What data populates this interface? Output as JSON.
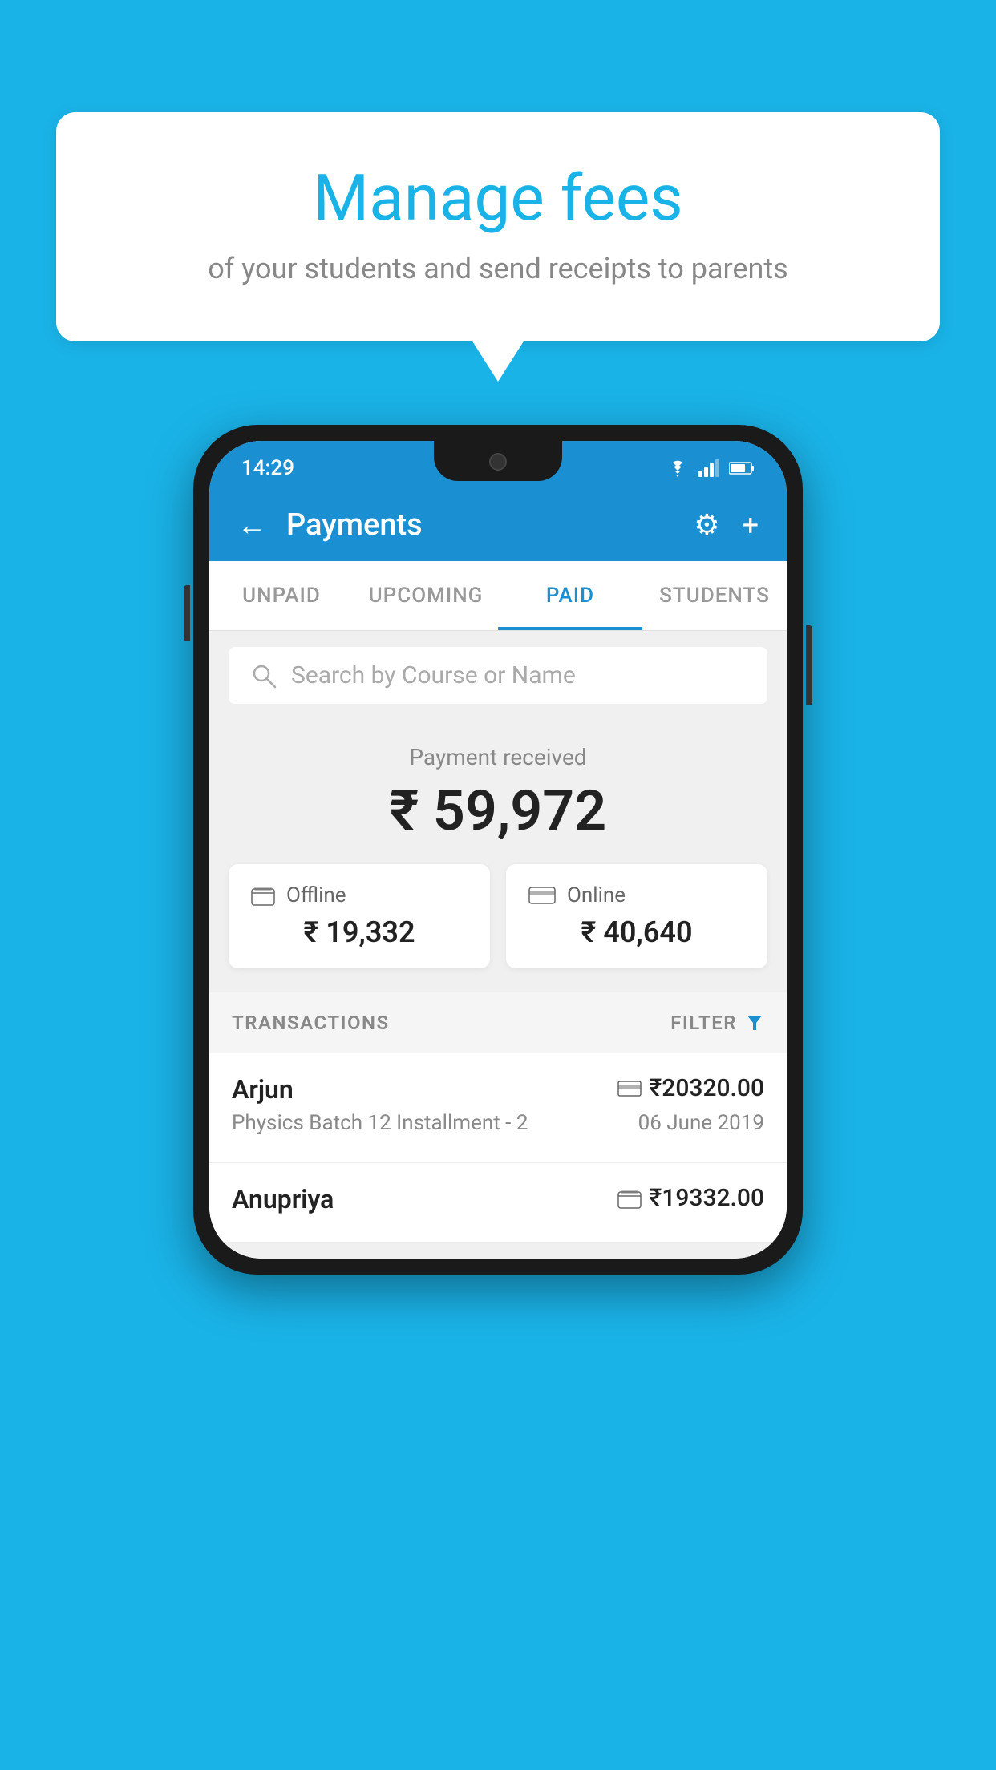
{
  "background_color": "#1ab3e8",
  "speech_bubble": {
    "title": "Manage fees",
    "subtitle": "of your students and send receipts to parents"
  },
  "status_bar": {
    "time": "14:29",
    "wifi": "▲",
    "signal": "▲",
    "battery": "▊"
  },
  "app_bar": {
    "title": "Payments",
    "back_label": "←",
    "gear_label": "⚙",
    "plus_label": "+"
  },
  "tabs": [
    {
      "label": "UNPAID",
      "active": false
    },
    {
      "label": "UPCOMING",
      "active": false
    },
    {
      "label": "PAID",
      "active": true
    },
    {
      "label": "STUDENTS",
      "active": false
    }
  ],
  "search": {
    "placeholder": "Search by Course or Name"
  },
  "payment_summary": {
    "label": "Payment received",
    "amount": "₹ 59,972",
    "offline": {
      "label": "Offline",
      "amount": "₹ 19,332"
    },
    "online": {
      "label": "Online",
      "amount": "₹ 40,640"
    }
  },
  "transactions_header": {
    "label": "TRANSACTIONS",
    "filter_label": "FILTER"
  },
  "transactions": [
    {
      "name": "Arjun",
      "course": "Physics Batch 12 Installment - 2",
      "amount": "₹20320.00",
      "date": "06 June 2019",
      "type": "online"
    },
    {
      "name": "Anupriya",
      "course": "",
      "amount": "₹19332.00",
      "date": "",
      "type": "offline"
    }
  ]
}
